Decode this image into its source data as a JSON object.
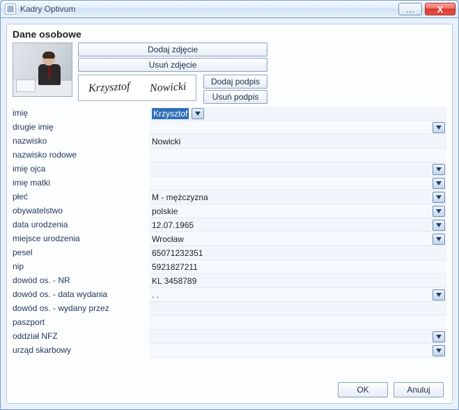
{
  "window": {
    "title": "Kadry Optivum",
    "close_glyph": "X",
    "dots_glyph": "…"
  },
  "section_title": "Dane osobowe",
  "photo_buttons": {
    "add_photo": "Dodaj zdjęcie",
    "remove_photo": "Usuń zdjęcie"
  },
  "signature": {
    "text_first": "Krzysztof",
    "text_last": "Nowicki",
    "add": "Dodaj podpis",
    "remove": "Usuń podpis"
  },
  "fields": {
    "imie": {
      "label": "imię",
      "value": "Krzysztof"
    },
    "drugie_imie": {
      "label": "drugie imię",
      "value": ""
    },
    "nazwisko": {
      "label": "nazwisko",
      "value": "Nowicki"
    },
    "nazwisko_rodowe": {
      "label": "nazwisko rodowe",
      "value": ""
    },
    "imie_ojca": {
      "label": "imię ojca",
      "value": ""
    },
    "imie_matki": {
      "label": "imię matki",
      "value": ""
    },
    "plec": {
      "label": "płeć",
      "value": "M - mężczyzna"
    },
    "obywatelstwo": {
      "label": "obywatelstwo",
      "value": "polskie"
    },
    "data_urodzenia": {
      "label": "data urodzenia",
      "value": "12.07.1965"
    },
    "miejsce_urodzenia": {
      "label": "miejsce urodzenia",
      "value": "Wrocław"
    },
    "pesel": {
      "label": "pesel",
      "value": "65071232351"
    },
    "nip": {
      "label": "nip",
      "value": "5921827211"
    },
    "dowod_nr": {
      "label": "dowód os. - NR",
      "value": "KL 3458789"
    },
    "dowod_data": {
      "label": "dowód os. - data wydania",
      "value": "  .  ."
    },
    "dowod_przez": {
      "label": "dowód os. - wydany przez",
      "value": ""
    },
    "paszport": {
      "label": "paszport",
      "value": ""
    },
    "oddzial_nfz": {
      "label": "oddział NFZ",
      "value": ""
    },
    "urzad_skarbowy": {
      "label": "urząd skarbowy",
      "value": ""
    }
  },
  "footer": {
    "ok": "OK",
    "cancel": "Anuluj"
  }
}
